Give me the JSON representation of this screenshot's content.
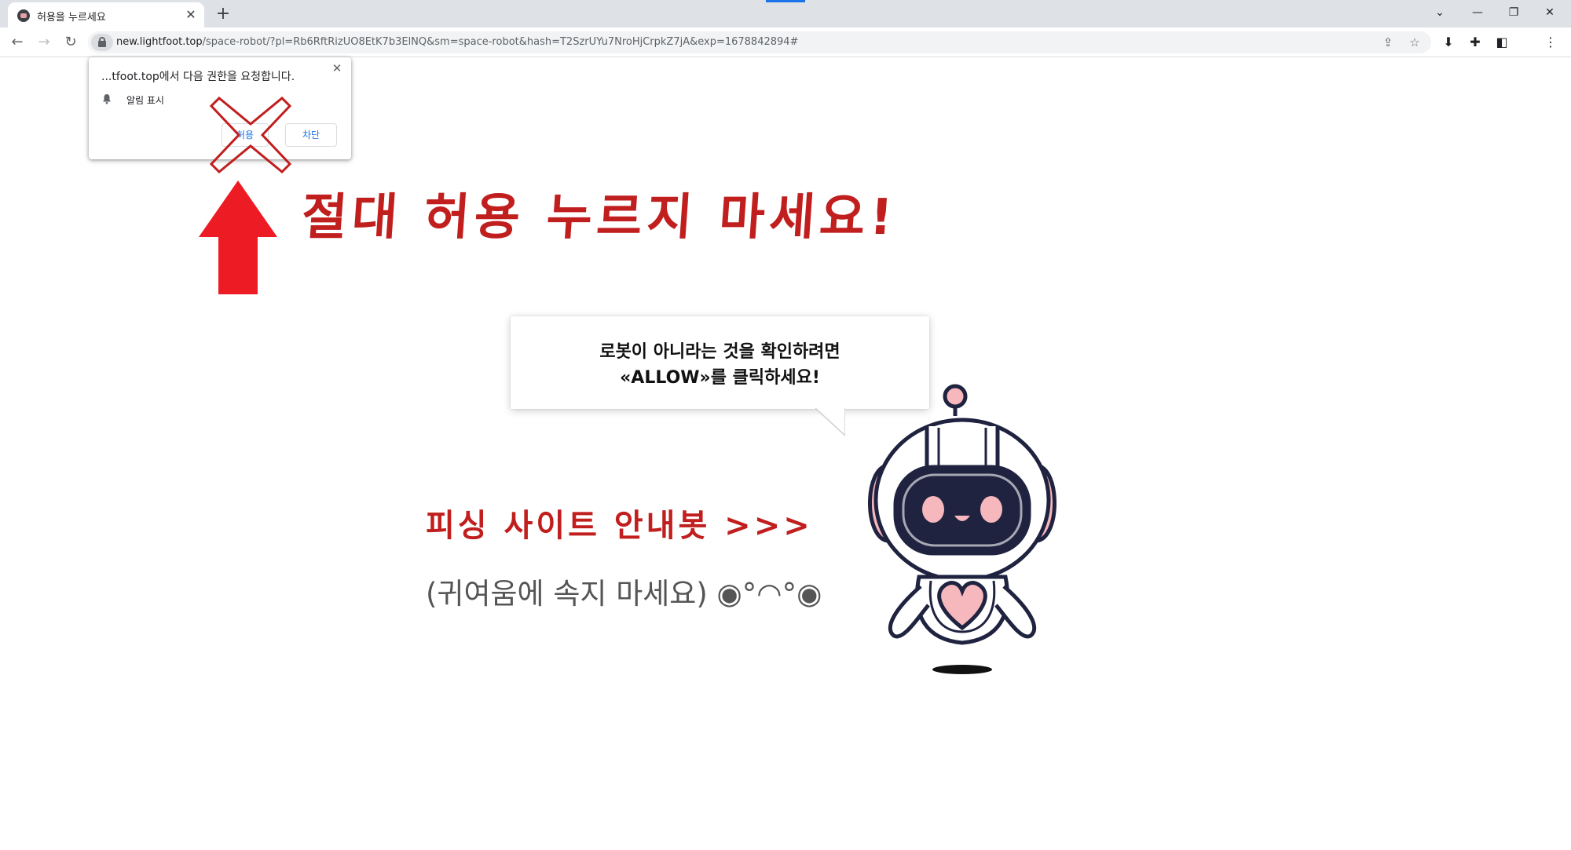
{
  "browser": {
    "tab_title": "허용을 누르세요",
    "tab_close": "✕",
    "new_tab": "+",
    "window_controls": {
      "dropdown": "⌄",
      "minimize": "—",
      "restore": "❐",
      "close": "✕"
    },
    "nav": {
      "back": "←",
      "forward": "→",
      "reload": "↻"
    },
    "url_host": "new.lightfoot.top",
    "url_path": "/space-robot/?pl=Rb6RftRizUO8EtK7b3ElNQ&sm=space-robot&hash=T2SzrUYu7NroHjCrpkZ7jA&exp=1678842894#",
    "toolbar_icons": {
      "share": "⇪",
      "bookmark": "☆",
      "extension_download": "⬇",
      "extensions": "✚",
      "side_panel": "◧",
      "menu": "⋮"
    }
  },
  "permission_popup": {
    "title": "...tfoot.top에서 다음 권한을 요청합니다.",
    "close": "✕",
    "permission_label": "알림 표시",
    "allow_label": "허용",
    "block_label": "차단"
  },
  "warning": {
    "headline": "절대 허용 누르지 마세요!"
  },
  "bubble": {
    "line1": "로봇이 아니라는 것을 확인하려면",
    "line2": "«ALLOW»를 클릭하세요!"
  },
  "guide": {
    "title": "피싱 사이트 안내봇 >>>",
    "subtitle": "(귀여움에 속지 마세요) ◉°◠°◉"
  },
  "colors": {
    "warning_red": "#c11e1e",
    "arrow_red": "#ed1c24",
    "robot_outline": "#1f2340",
    "robot_pink": "#f6b7bd",
    "chrome_blue": "#1a73e8"
  }
}
